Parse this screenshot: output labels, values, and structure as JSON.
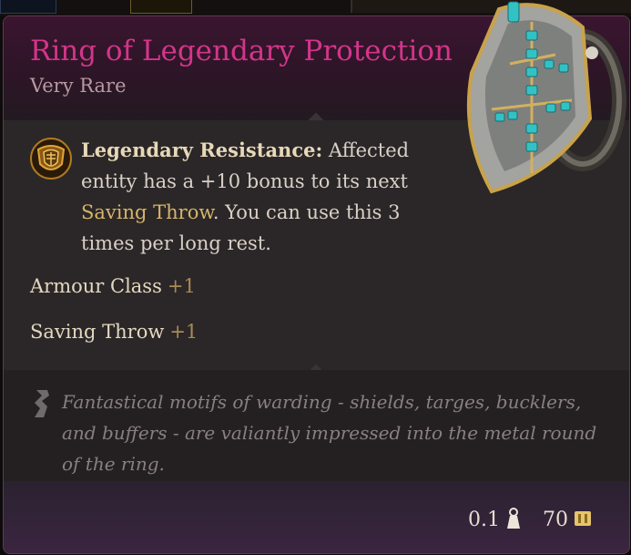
{
  "item": {
    "name": "Ring of Legendary Protection",
    "rarity": "Very Rare"
  },
  "ability": {
    "icon": "legendary-resistance-shield-icon",
    "name": "Legendary Resistance:",
    "text_a": " Affected entity has a +10 bonus to its next ",
    "link": "Saving Throw",
    "text_b": ". You can use this 3 times per long rest."
  },
  "stats": [
    {
      "label": "Armour Class",
      "bonus": "+1"
    },
    {
      "label": "Saving Throw",
      "bonus": "+1"
    }
  ],
  "flavor": {
    "icon": "quill-icon",
    "text": "Fantastical motifs of warding - shields, targes, bucklers, and buffers - are valiantly impressed into the metal round of the ring."
  },
  "footer": {
    "weight": "0.1",
    "weight_icon": "weight-icon",
    "value": "70",
    "value_icon": "gold-coin-icon"
  },
  "colors": {
    "title": "#d3358a",
    "highlight": "#d6b46a",
    "bonus": "#a88a58"
  }
}
